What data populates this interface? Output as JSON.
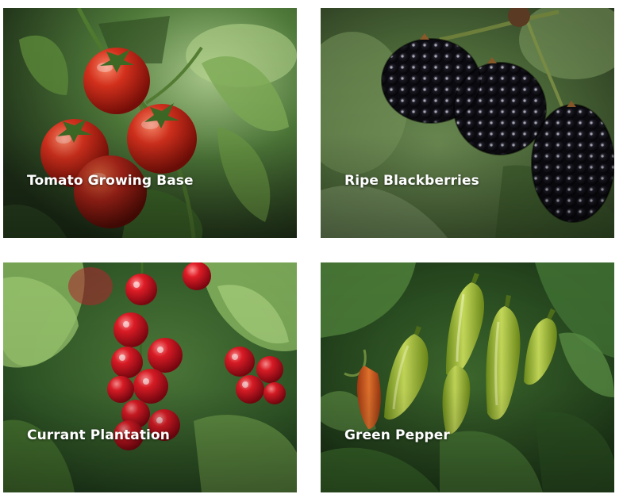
{
  "gallery": {
    "cards": [
      {
        "caption": "Tomato Growing Base",
        "photo": "tomato-photo"
      },
      {
        "caption": "Ripe Blackberries",
        "photo": "blackberry-photo"
      },
      {
        "caption": "Currant Plantation",
        "photo": "currant-photo"
      },
      {
        "caption": "Green Pepper",
        "photo": "pepper-photo"
      }
    ]
  },
  "colors": {
    "caption_text": "#ffffff",
    "page_background": "#ffffff"
  }
}
